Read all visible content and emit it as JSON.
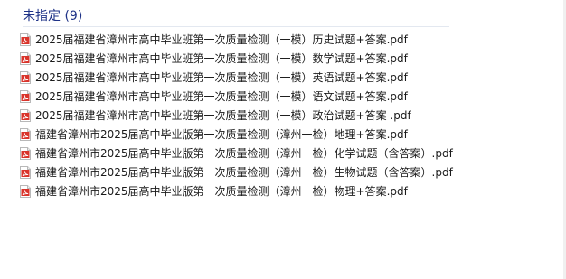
{
  "group": {
    "title": "未指定 (9)"
  },
  "files": [
    {
      "name": "2025届福建省漳州市高中毕业班第一次质量检测（一模）历史试题+答案.pdf",
      "icon": "pdf-icon"
    },
    {
      "name": "2025届福建省漳州市高中毕业班第一次质量检测（一模）数学试题+答案.pdf",
      "icon": "pdf-icon"
    },
    {
      "name": "2025届福建省漳州市高中毕业班第一次质量检测（一模）英语试题+答案.pdf",
      "icon": "pdf-icon"
    },
    {
      "name": "2025届福建省漳州市高中毕业班第一次质量检测（一模）语文试题+答案.pdf",
      "icon": "pdf-icon"
    },
    {
      "name": "2025届福建省漳州市高中毕业班第一次质量检测（一模）政治试题+答案 .pdf",
      "icon": "pdf-icon"
    },
    {
      "name": "福建省漳州市2025届高中毕业版第一次质量检测（漳州一检）地理+答案.pdf",
      "icon": "pdf-icon"
    },
    {
      "name": "福建省漳州市2025届高中毕业版第一次质量检测（漳州一检）化学试题（含答案）.pdf",
      "icon": "pdf-icon"
    },
    {
      "name": "福建省漳州市2025届高中毕业版第一次质量检测（漳州一检）生物试题（含答案）.pdf",
      "icon": "pdf-icon"
    },
    {
      "name": "福建省漳州市2025届高中毕业版第一次质量检测（漳州一检）物理+答案.pdf",
      "icon": "pdf-icon"
    }
  ],
  "colors": {
    "group_title": "#1e3287",
    "pdf_icon_red": "#d9342b"
  }
}
